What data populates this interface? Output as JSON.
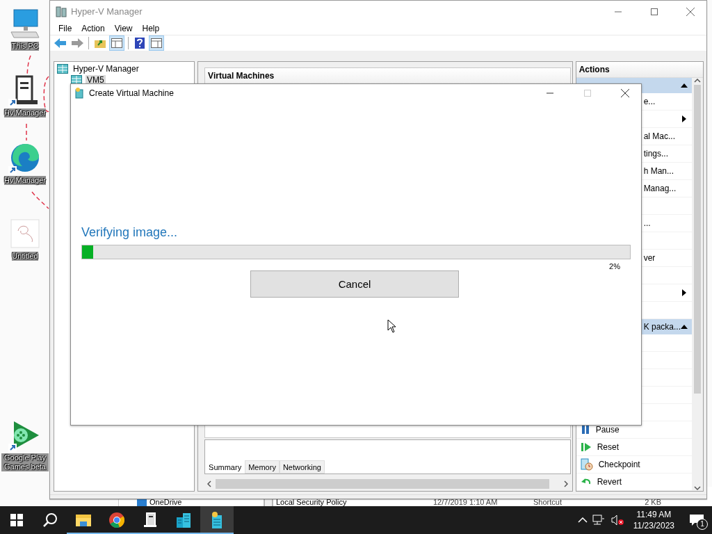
{
  "desktop_icons": [
    {
      "label": "This PC",
      "kind": "pc",
      "shortcut": false
    },
    {
      "label": "Hv Manager",
      "kind": "server",
      "shortcut": true
    },
    {
      "label": "Hv Manager",
      "kind": "edge",
      "shortcut": true
    },
    {
      "label": "Untitled",
      "kind": "paint",
      "shortcut": false
    },
    {
      "label": "Google Play Games beta",
      "kind": "play",
      "shortcut": true
    }
  ],
  "explorer": {
    "nav_items": [
      "OneDrive"
    ],
    "rows": [
      {
        "name": "Local Security Policy",
        "modified": "12/7/2019 1:10 AM",
        "type": "Shortcut",
        "size": "2 KB"
      }
    ]
  },
  "hyperv": {
    "title": "Hyper-V Manager",
    "menu": [
      "File",
      "Action",
      "View",
      "Help"
    ],
    "tree": [
      {
        "label": "Hyper-V Manager",
        "children": [
          {
            "label": "VM5",
            "selected": true
          }
        ]
      }
    ],
    "center": {
      "title": "Virtual Machines",
      "tabs": [
        {
          "label": "Summary",
          "selected": true
        },
        {
          "label": "Memory",
          "selected": false
        },
        {
          "label": "Networking",
          "selected": false
        }
      ]
    },
    "actions": {
      "title": "Actions",
      "items": [
        {
          "kind": "header"
        },
        {
          "kind": "clipped",
          "text": "e..."
        },
        {
          "kind": "submenu"
        },
        {
          "kind": "clipped",
          "text": "al Mac..."
        },
        {
          "kind": "clipped",
          "text": "tings..."
        },
        {
          "kind": "clipped",
          "text": "h Man..."
        },
        {
          "kind": "clipped",
          "text": "Manag..."
        },
        {
          "kind": "blank"
        },
        {
          "kind": "clipped",
          "text": "..."
        },
        {
          "kind": "blank"
        },
        {
          "kind": "clipped",
          "text": "ver"
        },
        {
          "kind": "blank"
        },
        {
          "kind": "submenu"
        },
        {
          "kind": "blank"
        },
        {
          "kind": "header",
          "text": "K packa..."
        },
        {
          "kind": "blank"
        },
        {
          "kind": "blank"
        },
        {
          "kind": "blank"
        },
        {
          "kind": "blank"
        },
        {
          "kind": "blank"
        },
        {
          "kind": "pause",
          "text": "Pause"
        },
        {
          "kind": "reset",
          "text": "Reset"
        },
        {
          "kind": "checkpoint",
          "text": "Checkpoint"
        },
        {
          "kind": "revert",
          "text": "Revert"
        }
      ]
    }
  },
  "dialog": {
    "title": "Create Virtual Machine",
    "status": "Verifying image...",
    "progress": {
      "level": 0.02,
      "reading": "2%"
    },
    "button": "Cancel"
  },
  "taskbar": {
    "items": [
      {
        "kind": "explorer",
        "selected": false
      },
      {
        "kind": "chrome",
        "selected": false
      },
      {
        "kind": "server",
        "selected": false
      },
      {
        "kind": "building",
        "selected": false
      },
      {
        "kind": "hyperv",
        "selected": true
      }
    ],
    "clock": {
      "time": "11:49 AM",
      "date": "11/23/2023"
    },
    "notifications": "1"
  }
}
